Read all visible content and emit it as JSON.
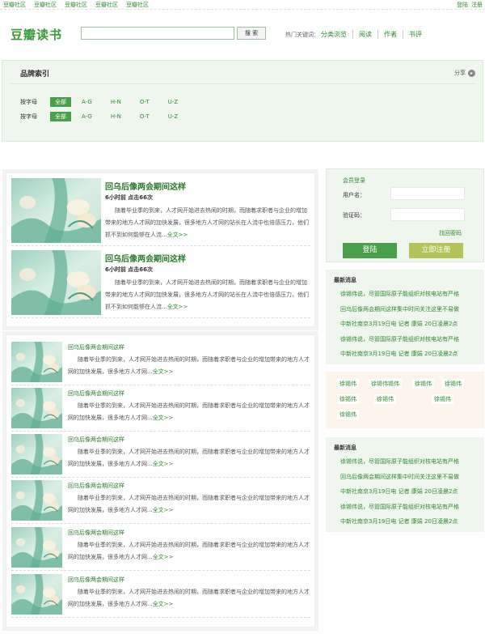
{
  "topbar": {
    "links": [
      "豆瓣社区",
      "豆瓣社区",
      "豆瓣社区",
      "豆瓣社区",
      "豆瓣社区"
    ],
    "login": "登陆",
    "register": "注册"
  },
  "header": {
    "logo": "豆瓣读书",
    "search_placeholder": "",
    "search_button": "搜 索",
    "hot_label": "热门关键词：",
    "hot_keywords": [
      "分类浏览",
      "阅读",
      "作者",
      "书评"
    ]
  },
  "brand_index": {
    "title": "品牌索引",
    "share": "分享",
    "rows": [
      {
        "label": "按字母",
        "all": "全部",
        "options": [
          "A-G",
          "H-N",
          "O-T",
          "U-Z"
        ]
      },
      {
        "label": "按字母",
        "all": "全部",
        "options": [
          "A-G",
          "H-N",
          "O-T",
          "U-Z"
        ]
      }
    ]
  },
  "featured": [
    {
      "title": "回乌后像两会期间这样",
      "meta": "6小时前  点击66次",
      "desc": "随着毕业季的到来，人才网开始进去热闹的时期，而随着求职者与企业的增加带来的地方人才网的加快发展，很多地方人才网的站长在人流中也倍感压力，他们抓不到如何能够在人流...",
      "more": "全文>>"
    },
    {
      "title": "回乌后像两会期间这样",
      "meta": "6小时前  点击66次",
      "desc": "随着毕业季的到来，人才网开始进去热闹的时期，而随着求职者与企业的增加带来的地方人才网的加快发展，很多地方人才网的站长在人流中也倍感压力，他们抓不到如何能够在人流...",
      "more": "全文>>"
    }
  ],
  "articles": [
    {
      "title": "回乌后像两会期间这样",
      "desc": "随着毕业季的到来，人才网开始进去热闹的时期，而随着求职者与企业的增加带来的地方人才网的加快发展，很多地方人才网...",
      "more": "全文>>"
    },
    {
      "title": "回乌后像两会期间这样",
      "desc": "随着毕业季的到来，人才网开始进去热闹的时期，而随着求职者与企业的增加带来的地方人才网的加快发展，很多地方人才网...",
      "more": "全文>>"
    },
    {
      "title": "回乌后像两会期间这样",
      "desc": "随着毕业季的到来，人才网开始进去热闹的时期，而随着求职者与企业的增加带来的地方人才网的加快发展，很多地方人才网...",
      "more": "全文>>"
    },
    {
      "title": "回乌后像两会期间这样",
      "desc": "随着毕业季的到来，人才网开始进去热闹的时期，而随着求职者与企业的增加带来的地方人才网的加快发展，很多地方人才网...",
      "more": "全文>>"
    },
    {
      "title": "回乌后像两会期间这样",
      "desc": "随着毕业季的到来，人才网开始进去热闹的时期，而随着求职者与企业的增加带来的地方人才网的加快发展，很多地方人才网...",
      "more": "全文>>"
    },
    {
      "title": "回乌后像两会期间这样",
      "desc": "随着毕业季的到来，人才网开始进去热闹的时期，而随着求职者与企业的增加带来的地方人才网的加快发展，很多地方人才网...",
      "more": "全文>>"
    }
  ],
  "login": {
    "title": "会员登录",
    "username_label": "用户名：",
    "code_label": "验证码：",
    "forgot": "找回密码",
    "login_button": "登陆",
    "register_button": "立即注册"
  },
  "news1": {
    "title": "最新消息",
    "items": [
      "徐锡伟说，尽管国际原子能组织对核电站有严格",
      "回乌后像两会期间这样集中时间关注这里不易做",
      "中新社南京3月19日电 记者 康娟 20日凌晨2点",
      "徐锡伟说，尽管国际原子能组织对核电站有严格",
      "中新社南京3月19日电 记者 康娟 20日凌晨2点"
    ]
  },
  "tags": [
    "徐锡伟",
    "徐锡伟锡伟",
    "徐锡伟",
    "徐锡伟",
    "徐锡伟",
    "徐锡伟",
    "徐锡伟",
    "徐锡伟"
  ],
  "news2": {
    "title": "最新消息",
    "items": [
      "徐锡伟说，尽管国际原子能组织对核电站有严格",
      "回乌后像两会期间这样集中时间关注这里不易做",
      "中新社南京3月19日电 记者 康娟 20日凌晨2点",
      "徐锡伟说，尽管国际原子能组织对核电站有严格",
      "中新社南京3月19日电 记者 康娟 20日凌晨2点"
    ]
  }
}
